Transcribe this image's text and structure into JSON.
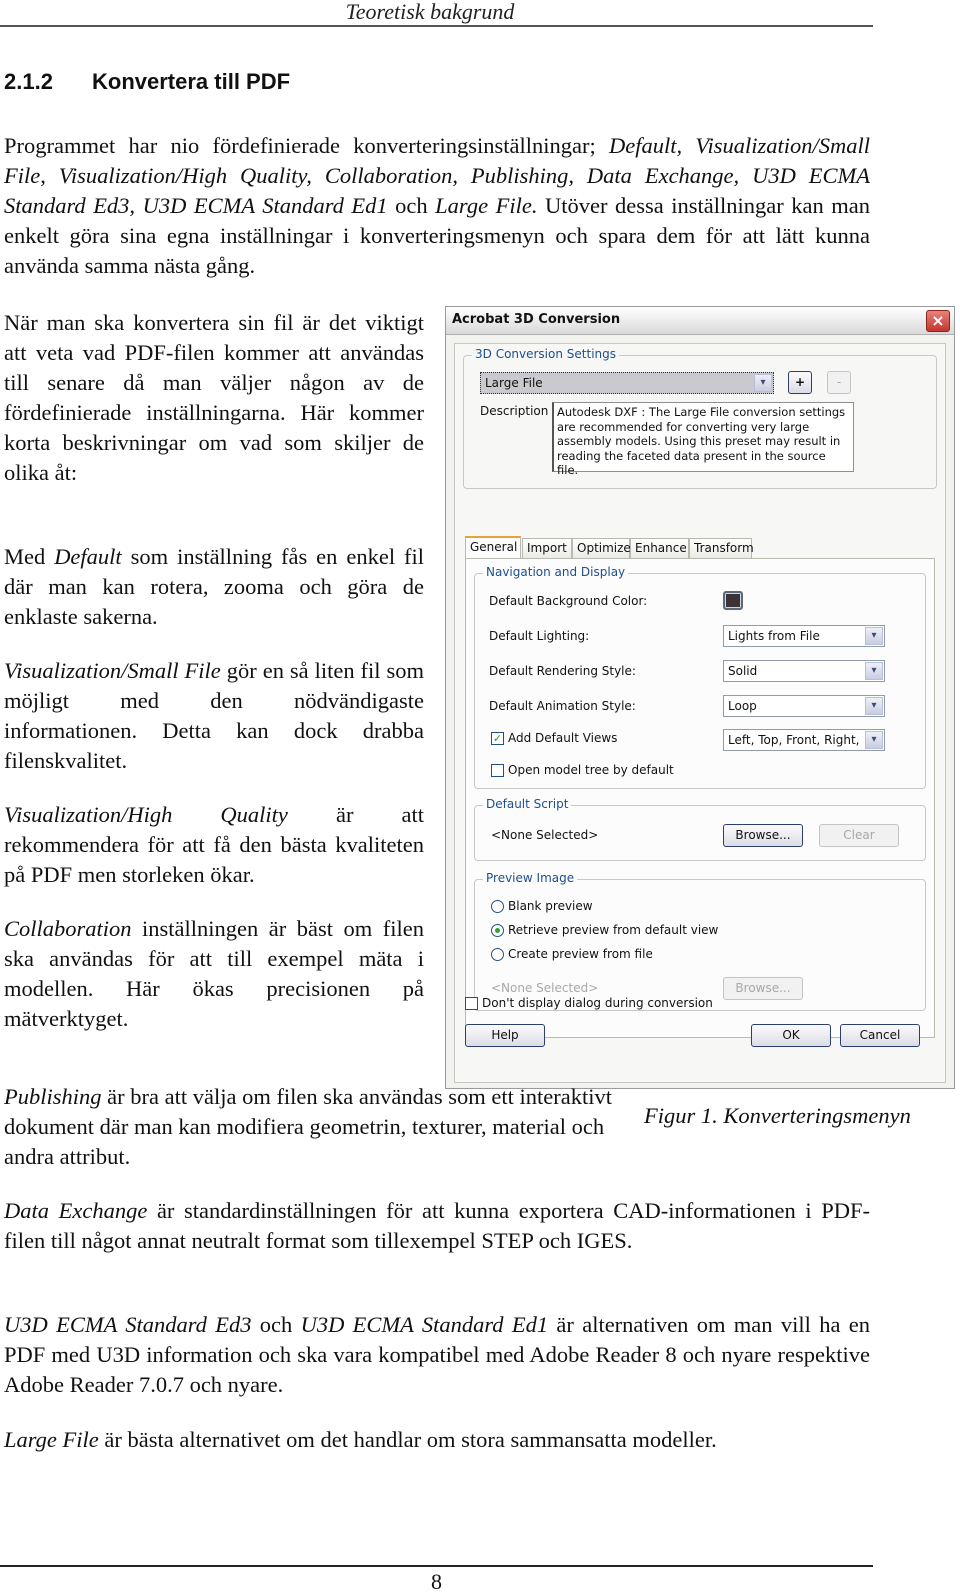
{
  "header": {
    "title": "Teoretisk bakgrund"
  },
  "section": {
    "number": "2.1.2",
    "title": "Konvertera till PDF"
  },
  "paragraphs": {
    "intro": {
      "t1": "Programmet har nio fördefinierade konverteringsinställningar; ",
      "i1": "Default, Visualization/Small File, Visualization/High Quality, Collaboration, Publishing, Data Exchange, U3D ECMA Standard Ed3, U3D ECMA Standard Ed1",
      "t2": " och ",
      "i2": "Large File.",
      "t3": " Utöver dessa inställningar kan man enkelt göra sina egna inställningar i konverteringsmenyn och spara dem för att lätt kunna använda samma nästa gång."
    },
    "when_converting": "När man ska konvertera sin fil är det viktigt att veta vad PDF-filen kommer att användas till senare då man väljer någon av de fördefinierade inställningarna. Här kommer korta beskrivningar om vad som skiljer de olika åt:",
    "default": {
      "t1": "Med ",
      "i1": "Default",
      "t2": " som inställning fås en enkel fil där man kan rotera, zooma och göra de enklaste sakerna."
    },
    "small_file": {
      "i1": "Visualization/Small File",
      "t1": " gör en så liten fil som möjligt med den nödvändigaste informationen. Detta kan dock drabba filenskvalitet."
    },
    "high_quality": {
      "i1": "Visualization/High Quality",
      "t1": " är att rekommendera för att få den bästa kvaliteten på PDF men storleken ökar."
    },
    "collaboration": {
      "i1": "Collaboration",
      "t1": " inställningen är bäst om filen ska användas för att till exempel mäta i modellen. Här ökas precisionen på mätverktyget."
    },
    "publishing": {
      "i1": "Publishing",
      "t1": " är bra att välja om filen ska användas som ett interaktivt dokument där man kan modifiera geometrin, texturer, material och andra attribut."
    },
    "data_exchange": {
      "i1": "Data Exchange",
      "t1": " är standardinställningen för att kunna exportera CAD-informationen i PDF-filen till något annat neutralt format som tillexempel STEP och IGES."
    },
    "u3d": {
      "i1": "U3D ECMA Standard Ed3",
      "t1": " och ",
      "i2": "U3D ECMA Standard Ed1",
      "t2": " är alternativen om man vill ha en PDF med U3D information och ska vara kompatibel med Adobe Reader 8 och nyare respektive Adobe Reader 7.0.7 och nyare."
    },
    "large_file": {
      "i1": "Large File",
      "t1": " är bästa alternativet om det handlar om stora sammansatta modeller."
    }
  },
  "figure": {
    "caption": "Figur 1. Konverteringsmenyn"
  },
  "dialog": {
    "title": "Acrobat 3D Conversion",
    "close_icon": "×",
    "settings_group": "3D Conversion Settings",
    "preset_value": "Large File",
    "add_label": "+",
    "remove_label": "-",
    "description_label": "Description",
    "description_text": "Autodesk DXF : The Large File conversion settings are recommended for converting very large assembly models. Using this preset may result in reading the faceted data present in the source file.",
    "tabs": [
      "General",
      "Import",
      "Optimize",
      "Enhance",
      "Transform"
    ],
    "active_tab": "General",
    "nav_group": "Navigation and Display",
    "bg_color_label": "Default Background Color:",
    "bg_color_value": "#3b3436",
    "lighting_label": "Default Lighting:",
    "lighting_value": "Lights from File",
    "rendering_label": "Default Rendering Style:",
    "rendering_value": "Solid",
    "animation_label": "Default Animation Style:",
    "animation_value": "Loop",
    "add_views_label": "Add Default Views",
    "add_views_checked": "✓",
    "views_value": "Left, Top, Front, Right, E",
    "open_tree_label": "Open model tree by default",
    "script_group": "Default Script",
    "script_value": "<None Selected>",
    "browse_label": "Browse...",
    "clear_label": "Clear",
    "preview_group": "Preview Image",
    "radio_blank": "Blank preview",
    "radio_default": "Retrieve preview from default view",
    "radio_file": "Create preview from file",
    "preview_file_value": "<None Selected>",
    "preview_browse_label": "Browse...",
    "dont_display_label": "Don't display dialog during conversion",
    "help_label": "Help",
    "ok_label": "OK",
    "cancel_label": "Cancel",
    "dropdown_arrow": "▾"
  },
  "footer": {
    "page_number": "8"
  }
}
